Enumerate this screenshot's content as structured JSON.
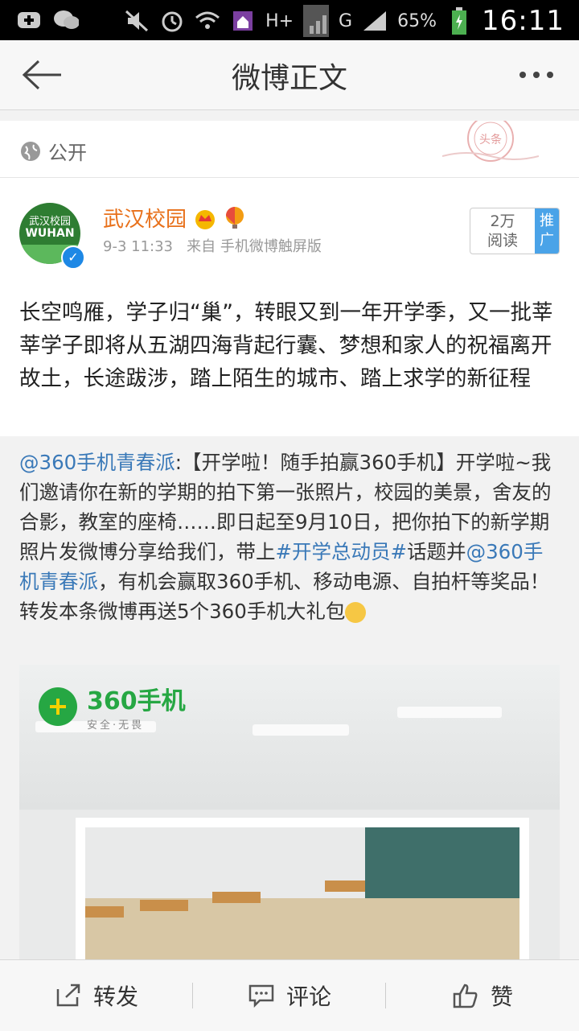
{
  "status_bar": {
    "battery": "65%",
    "network": "H+",
    "network2": "G",
    "time": "16:11"
  },
  "header": {
    "title": "微博正文"
  },
  "post": {
    "privacy": "公开",
    "stamp_text": "头条",
    "author": "武汉校园",
    "avatar_text_line1": "武汉校园",
    "avatar_text_line2": "WUHAN",
    "time": "9-3 11:33",
    "source": "来自 手机微博触屏版",
    "reads_count": "2万",
    "reads_label": "阅读",
    "promo_label": "推广",
    "text": "长空鸣雁，学子归“巢”，转眼又到一年开学季，又一批莘莘学子即将从五湖四海背起行囊、梦想和家人的祝福离开故土，长途跋涉，踏上陌生的城市、踏上求学的新征程"
  },
  "repost": {
    "mention": "@360手机青春派",
    "text1": ":【开学啦！随手拍赢360手机】开学啦~我们邀请你在新的学期的拍下第一张照片，校园的美景，舍友的合影，教室的座椅……即日起至9月10日，把你拍下的新学期照片发微博分享给我们，带上",
    "hashtag": "#开学总动员#",
    "text2": "话题并",
    "mention2": "@360手机青春派",
    "text3": "，有机会赢取360手机、移动电源、自拍杆等奖品！转发本条微博再送5个360手机大礼包",
    "image": {
      "brand_name": "360手机",
      "brand_slogan": "安全·无畏"
    }
  },
  "bottom_bar": {
    "repost_label": "转发",
    "comment_label": "评论",
    "like_label": "赞"
  }
}
